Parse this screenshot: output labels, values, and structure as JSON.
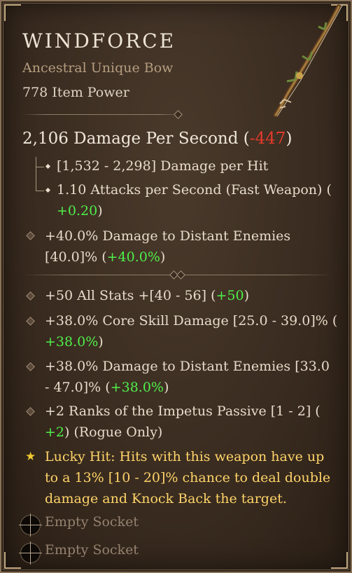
{
  "item": {
    "name": "WINDFORCE",
    "type": "Ancestral Unique Bow",
    "power": "778 Item Power"
  },
  "dps": {
    "value": "2,106 Damage Per Second",
    "open": " (",
    "delta": "-447",
    "close": ")"
  },
  "dps_sub": {
    "hit": "[1,532 - 2,298] Damage per Hit",
    "aps_line1": "1.10 Attacks per Second (Fast Weapon) (",
    "aps_delta": "+0.20",
    "aps_close": ")"
  },
  "implicit": {
    "line1": "+40.0% Damage to Distant Enemies",
    "line2_a": "[40.0]% (",
    "line2_delta": "+40.0%",
    "line2_b": ")"
  },
  "affixes": [
    {
      "a": "+50 All Stats +[40 - 56] (",
      "delta": "+50",
      "b": ")"
    },
    {
      "line1": "+38.0% Core Skill Damage [25.0 - 39.0]% (",
      "delta": "+38.0%",
      "b": ")"
    },
    {
      "line1": "+38.0% Damage to Distant Enemies [33.0",
      "a": "- 47.0]% (",
      "delta": "+38.0%",
      "b": ")"
    },
    {
      "line1": "+2 Ranks of the Impetus Passive [1 - 2] (",
      "delta": "+2",
      "b": ") (Rogue Only)"
    }
  ],
  "unique": {
    "line1": "Lucky Hit: Hits with this weapon have up",
    "line2": "to a 13% [10 - 20]% chance to deal double",
    "line3": "damage and Knock Back the target."
  },
  "sockets": [
    "Empty Socket",
    "Empty Socket"
  ],
  "colors": {
    "negative": "#e63a2a",
    "positive": "#4ff04a",
    "unique_text": "#ffd46a",
    "star": "#f1c932"
  },
  "icons": {
    "item": "bow-icon",
    "unique": "star-icon",
    "socket": "socket-icon"
  }
}
